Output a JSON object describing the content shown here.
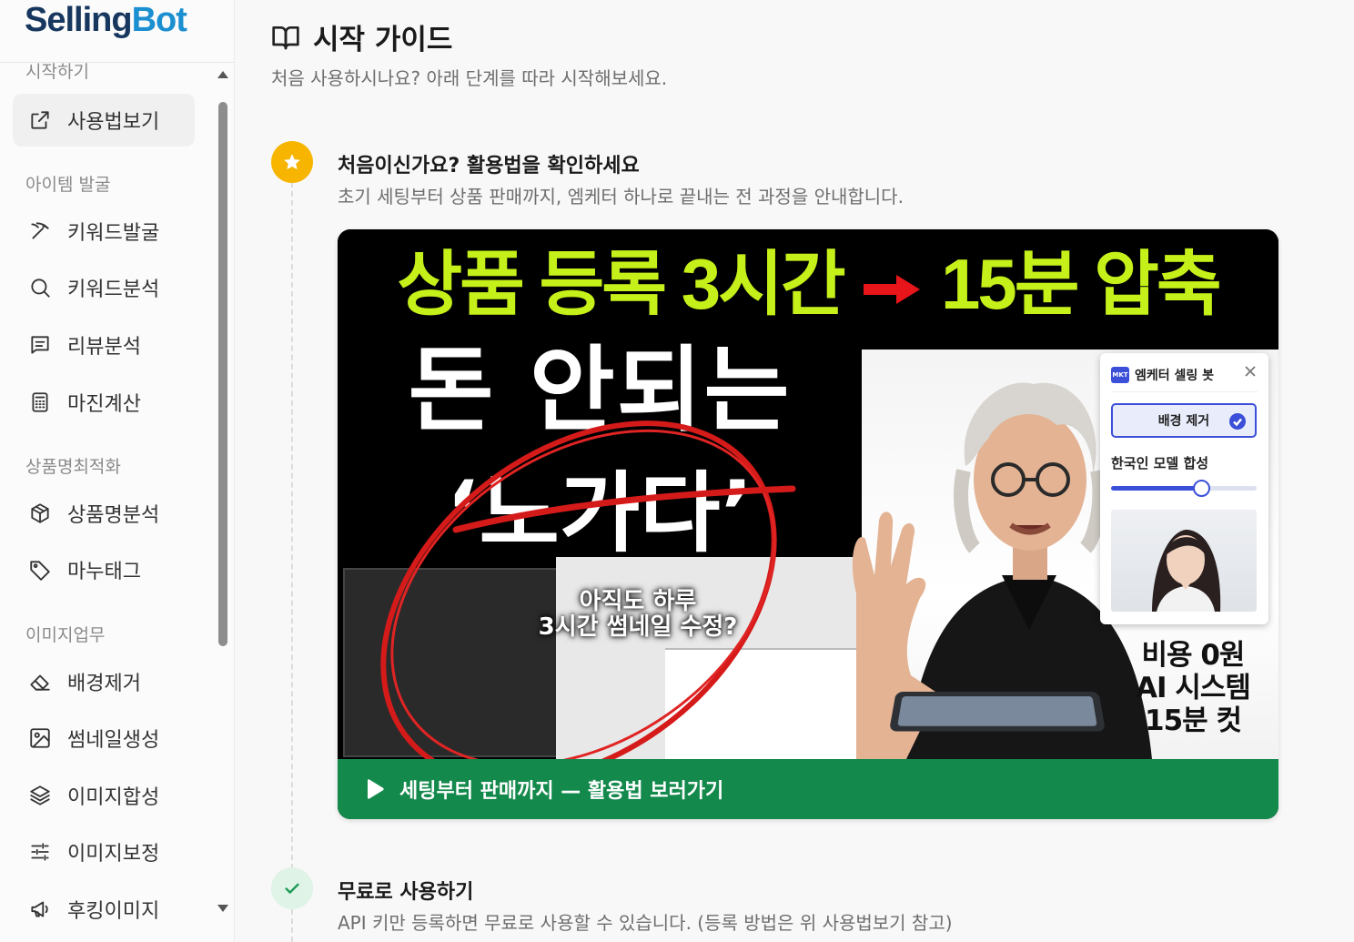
{
  "app": {
    "logo_part1": "Selling",
    "logo_part2": "Bot"
  },
  "sidebar": {
    "top_section": "시작하기",
    "active_item": "사용법보기",
    "sections": [
      {
        "label": "아이템 발굴",
        "items": [
          "키워드발굴",
          "키워드분석",
          "리뷰분석",
          "마진계산"
        ]
      },
      {
        "label": "상품명최적화",
        "items": [
          "상품명분석",
          "마누태그"
        ]
      },
      {
        "label": "이미지업무",
        "items": [
          "배경제거",
          "썸네일생성",
          "이미지합성",
          "이미지보정",
          "후킹이미지"
        ]
      }
    ]
  },
  "page": {
    "title": "시작 가이드",
    "subtitle": "처음 사용하시나요? 아래 단계를 따라 시작해보세요."
  },
  "steps": [
    {
      "title": "처음이신가요? 활용법을 확인하세요",
      "desc": "초기 세팅부터 상품 판매까지, 엠케터 하나로 끝내는 전 과정을 안내합니다.",
      "icon": "star-icon"
    },
    {
      "title": "무료로 사용하기",
      "desc": "API 키만 등록하면 무료로 사용할 수 있습니다. (등록 방법은 위 사용법보기 참고)",
      "icon": "check-icon"
    }
  ],
  "video": {
    "headline_left": "상품 등록 3시간",
    "headline_right": "15분 압축",
    "big_line1": "돈 안되는",
    "big_line2": "‘노가다’",
    "small_caption_line1": "아직도 하루",
    "small_caption_line2": "3시간 썸네일 수정?",
    "promo_line1": "비용 0원",
    "promo_line2": "AI 시스템",
    "promo_line3": "15분 컷",
    "panel": {
      "badge": "MKT",
      "name": "엠케터 셀링 봇",
      "button": "배경 제거",
      "label": "한국인 모델 합성",
      "slider_value": 0.62
    },
    "cta_label": "세팅부터 판매까지 — 활용법 보러가기"
  },
  "colors": {
    "accent_green": "#13894c",
    "headline_lime": "#c6f01a",
    "star_yellow": "#f7b500",
    "logo_navy": "#17375e",
    "logo_blue": "#1c8fd1",
    "panel_blue": "#3b4fd8"
  }
}
